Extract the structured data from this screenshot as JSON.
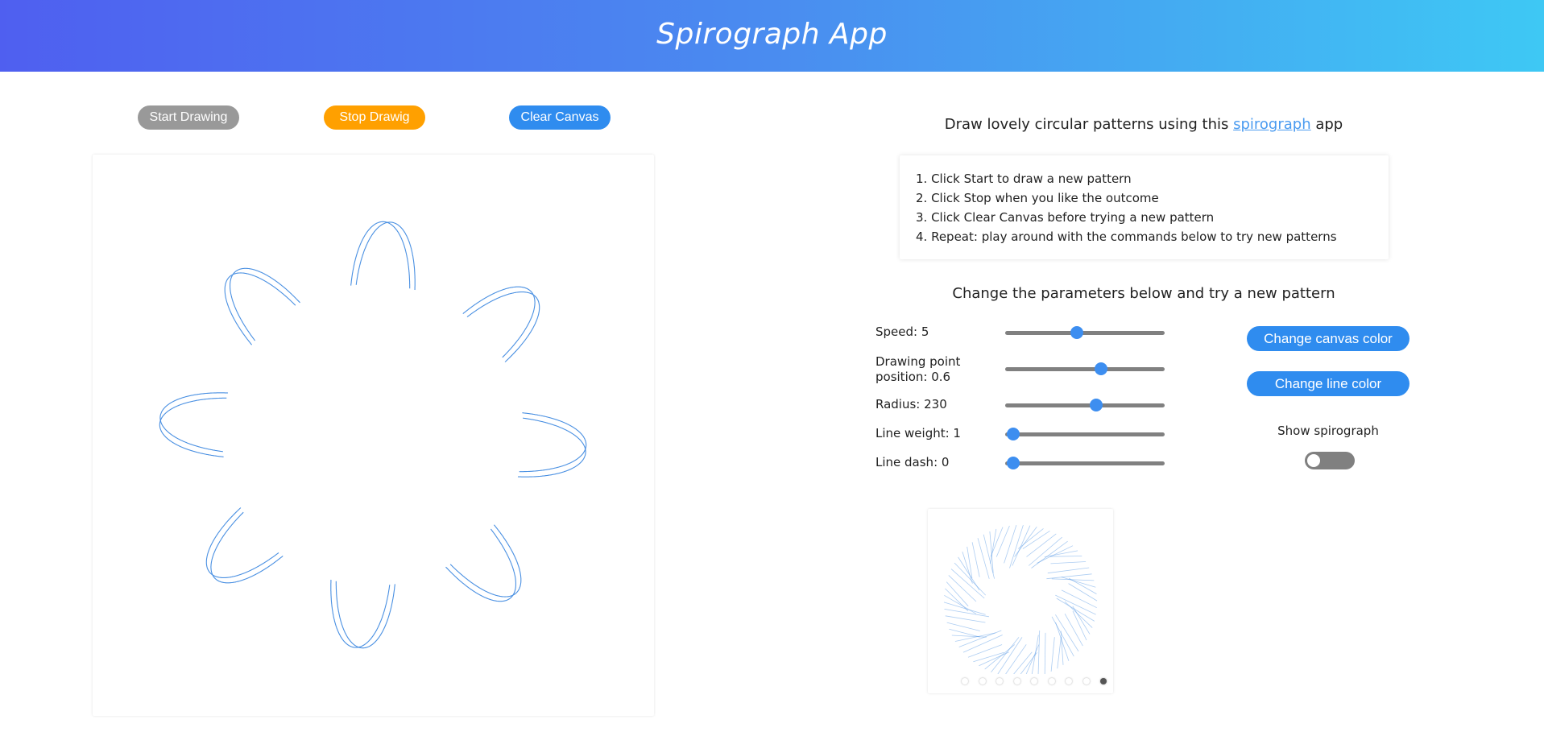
{
  "app": {
    "title": "Spirograph App"
  },
  "controls": {
    "start_label": "Start Drawing",
    "stop_label": "Stop Drawig",
    "clear_label": "Clear Canvas"
  },
  "intro": {
    "prefix": "Draw lovely circular patterns using this ",
    "link": "spirograph",
    "suffix": " app"
  },
  "steps": [
    "1. Click Start to draw a new pattern",
    "2. Click Stop when you like the outcome",
    "3. Click Clear Canvas before trying a new pattern",
    "4. Repeat: play around with the commands below to try new patterns"
  ],
  "params": {
    "title": "Change the parameters below and try a new pattern",
    "speed": {
      "label": "Speed: 5",
      "level": 0.45
    },
    "drawing_point": {
      "label_line1": "Drawing point",
      "label_line2": "position: 0.6",
      "level": 0.6
    },
    "radius": {
      "label": "Radius: 230",
      "level": 0.57
    },
    "line_weight": {
      "label": "Line weight: 1",
      "level": 0.05
    },
    "line_dash": {
      "label": "Line dash: 0",
      "level": 0.05
    }
  },
  "side": {
    "canvas_color_label": "Change canvas color",
    "line_color_label": "Change line color",
    "show_spirograph_label": "Show spirograph",
    "show_spirograph_on": false
  },
  "preview": {
    "dot_count": 9,
    "active_dot": 9
  },
  "colors": {
    "line": "#4a90e2",
    "accent": "#2f8cef",
    "stop": "#ffa000",
    "start": "#999999"
  }
}
